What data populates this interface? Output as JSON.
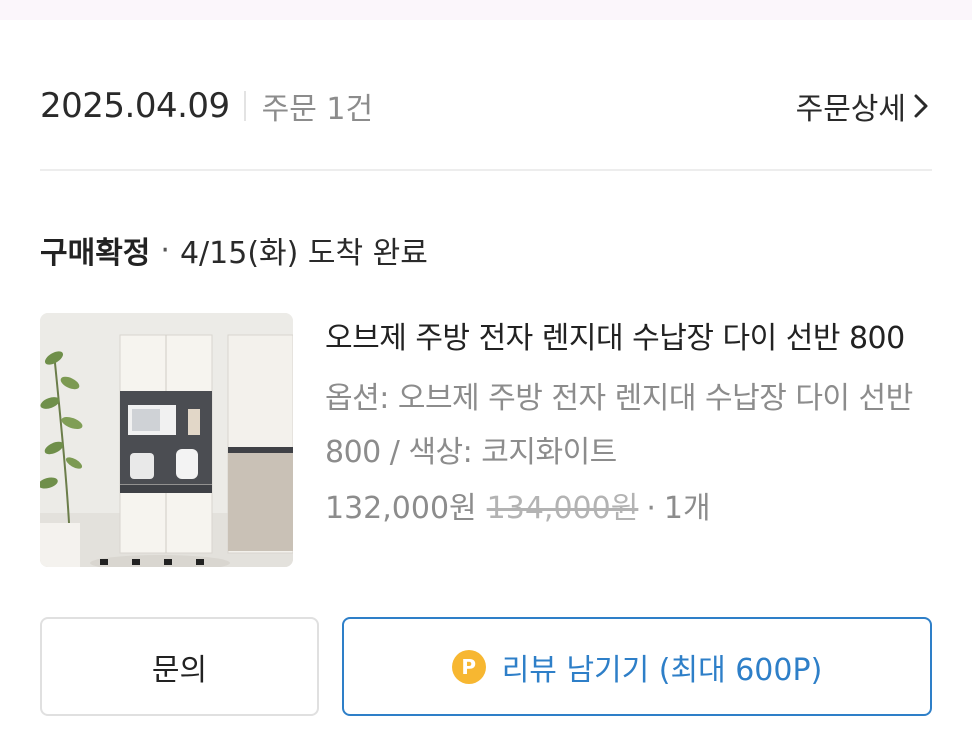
{
  "order": {
    "date": "2025.04.09",
    "count_label": "주문 1건",
    "detail_link": "주문상세"
  },
  "status": {
    "label": "구매확정",
    "separator": "·",
    "arrival": "4/15(화) 도착 완료"
  },
  "product": {
    "name": "오브제 주방 전자 렌지대 수납장 다이 선반 800",
    "option": "옵션: 오브제 주방 전자 렌지대 수납장 다이 선반 800 / 색상: 코지화이트",
    "price": "132,000원",
    "original_price": "134,000원",
    "qty_separator": "·",
    "quantity": "1개"
  },
  "actions": {
    "inquiry_label": "문의",
    "review_label": "리뷰 남기기 (최대 600P)",
    "point_icon_text": "P"
  },
  "colors": {
    "accent_blue": "#2e7fc8",
    "point_gold": "#f7b731"
  }
}
